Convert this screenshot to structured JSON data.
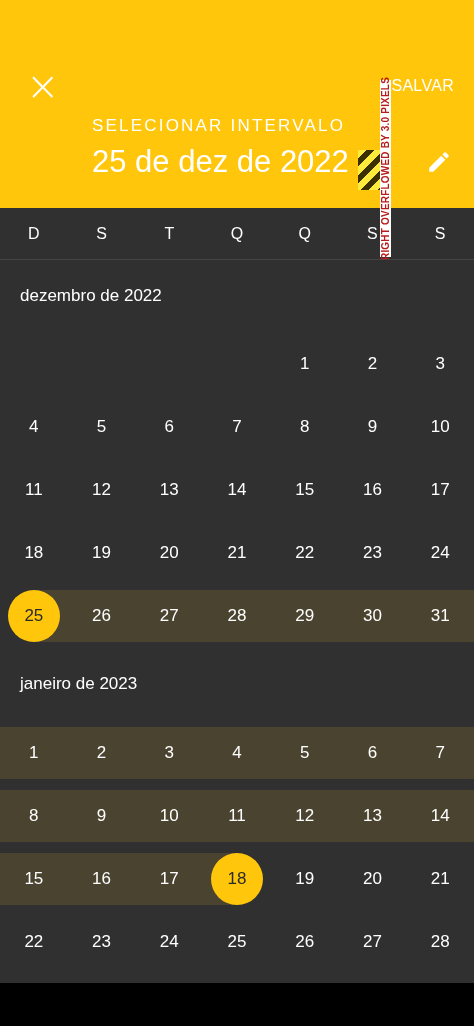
{
  "header": {
    "close": "×",
    "action": "SALVAR",
    "title": "SELECIONAR INTERVALO",
    "range_text": "25 de dez de 2022",
    "debug_overflow": "RIGHT OVERFLOWED BY 3.0 PIXELS"
  },
  "weekdays": [
    "D",
    "S",
    "T",
    "Q",
    "Q",
    "S",
    "S"
  ],
  "months": [
    {
      "label": "dezembro de 2022",
      "weeks": [
        [
          {
            "label": "1",
            "selected": false,
            "in_range": false
          },
          {
            "label": "2",
            "selected": false,
            "in_range": false
          },
          {
            "label": "3",
            "selected": false,
            "in_range": false
          }
        ],
        [
          {
            "label": "4",
            "selected": false,
            "in_range": false
          },
          {
            "label": "5",
            "selected": false,
            "in_range": false
          },
          {
            "label": "6",
            "selected": false,
            "in_range": false
          },
          {
            "label": "7",
            "selected": false,
            "in_range": false
          },
          {
            "label": "8",
            "selected": false,
            "in_range": false
          },
          {
            "label": "9",
            "selected": false,
            "in_range": false
          },
          {
            "label": "10",
            "selected": false,
            "in_range": false
          }
        ],
        [
          {
            "label": "11",
            "selected": false,
            "in_range": false
          },
          {
            "label": "12",
            "selected": false,
            "in_range": false
          },
          {
            "label": "13",
            "selected": false,
            "in_range": false
          },
          {
            "label": "14",
            "selected": false,
            "in_range": false
          },
          {
            "label": "15",
            "selected": false,
            "in_range": false
          },
          {
            "label": "16",
            "selected": false,
            "in_range": false
          },
          {
            "label": "17",
            "selected": false,
            "in_range": false
          }
        ],
        [
          {
            "label": "18",
            "selected": false,
            "in_range": false
          },
          {
            "label": "19",
            "selected": false,
            "in_range": false
          },
          {
            "label": "20",
            "selected": false,
            "in_range": false
          },
          {
            "label": "21",
            "selected": false,
            "in_range": false
          },
          {
            "label": "22",
            "selected": false,
            "in_range": false
          },
          {
            "label": "23",
            "selected": false,
            "in_range": false
          },
          {
            "label": "24",
            "selected": false,
            "in_range": false
          }
        ],
        [
          {
            "label": "25",
            "selected": true,
            "in_range": true
          },
          {
            "label": "26",
            "selected": false,
            "in_range": true
          },
          {
            "label": "27",
            "selected": false,
            "in_range": true
          },
          {
            "label": "28",
            "selected": false,
            "in_range": true
          },
          {
            "label": "29",
            "selected": false,
            "in_range": true
          },
          {
            "label": "30",
            "selected": false,
            "in_range": true
          },
          {
            "label": "31",
            "selected": false,
            "in_range": true
          }
        ]
      ]
    },
    {
      "label": "janeiro de 2023",
      "weeks": [
        [
          {
            "label": "1",
            "selected": false,
            "in_range": true
          },
          {
            "label": "2",
            "selected": false,
            "in_range": true
          },
          {
            "label": "3",
            "selected": false,
            "in_range": true
          },
          {
            "label": "4",
            "selected": false,
            "in_range": true
          },
          {
            "label": "5",
            "selected": false,
            "in_range": true
          },
          {
            "label": "6",
            "selected": false,
            "in_range": true
          },
          {
            "label": "7",
            "selected": false,
            "in_range": true
          }
        ],
        [
          {
            "label": "8",
            "selected": false,
            "in_range": true
          },
          {
            "label": "9",
            "selected": false,
            "in_range": true
          },
          {
            "label": "10",
            "selected": false,
            "in_range": true
          },
          {
            "label": "11",
            "selected": false,
            "in_range": true
          },
          {
            "label": "12",
            "selected": false,
            "in_range": true
          },
          {
            "label": "13",
            "selected": false,
            "in_range": true
          },
          {
            "label": "14",
            "selected": false,
            "in_range": true
          }
        ],
        [
          {
            "label": "15",
            "selected": false,
            "in_range": true
          },
          {
            "label": "16",
            "selected": false,
            "in_range": true
          },
          {
            "label": "17",
            "selected": false,
            "in_range": true
          },
          {
            "label": "18",
            "selected": true,
            "in_range": true
          },
          {
            "label": "19",
            "selected": false,
            "in_range": false
          },
          {
            "label": "20",
            "selected": false,
            "in_range": false
          },
          {
            "label": "21",
            "selected": false,
            "in_range": false
          }
        ],
        [
          {
            "label": "22",
            "selected": false,
            "in_range": false
          },
          {
            "label": "23",
            "selected": false,
            "in_range": false
          },
          {
            "label": "24",
            "selected": false,
            "in_range": false
          },
          {
            "label": "25",
            "selected": false,
            "in_range": false
          },
          {
            "label": "26",
            "selected": false,
            "in_range": false
          },
          {
            "label": "27",
            "selected": false,
            "in_range": false
          },
          {
            "label": "28",
            "selected": false,
            "in_range": false
          }
        ]
      ]
    }
  ]
}
